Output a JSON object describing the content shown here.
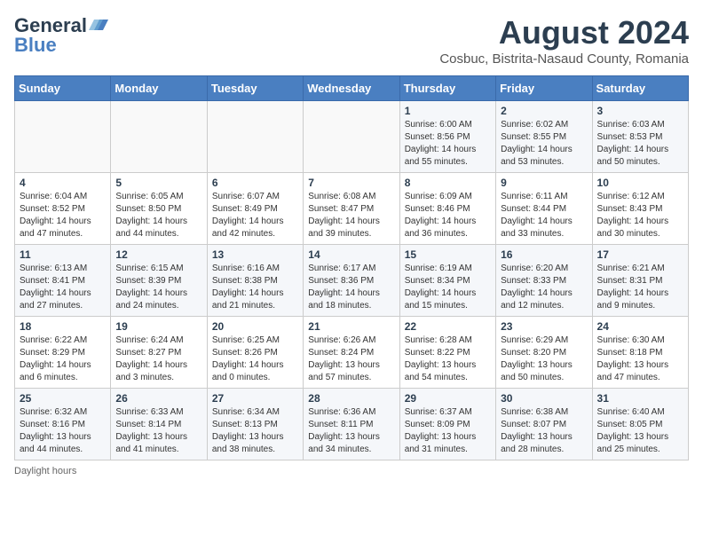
{
  "header": {
    "logo_line1": "General",
    "logo_line2": "Blue",
    "month_year": "August 2024",
    "location": "Cosbuc, Bistrita-Nasaud County, Romania"
  },
  "days_of_week": [
    "Sunday",
    "Monday",
    "Tuesday",
    "Wednesday",
    "Thursday",
    "Friday",
    "Saturday"
  ],
  "weeks": [
    [
      {
        "day": "",
        "info": ""
      },
      {
        "day": "",
        "info": ""
      },
      {
        "day": "",
        "info": ""
      },
      {
        "day": "",
        "info": ""
      },
      {
        "day": "1",
        "info": "Sunrise: 6:00 AM\nSunset: 8:56 PM\nDaylight: 14 hours\nand 55 minutes."
      },
      {
        "day": "2",
        "info": "Sunrise: 6:02 AM\nSunset: 8:55 PM\nDaylight: 14 hours\nand 53 minutes."
      },
      {
        "day": "3",
        "info": "Sunrise: 6:03 AM\nSunset: 8:53 PM\nDaylight: 14 hours\nand 50 minutes."
      }
    ],
    [
      {
        "day": "4",
        "info": "Sunrise: 6:04 AM\nSunset: 8:52 PM\nDaylight: 14 hours\nand 47 minutes."
      },
      {
        "day": "5",
        "info": "Sunrise: 6:05 AM\nSunset: 8:50 PM\nDaylight: 14 hours\nand 44 minutes."
      },
      {
        "day": "6",
        "info": "Sunrise: 6:07 AM\nSunset: 8:49 PM\nDaylight: 14 hours\nand 42 minutes."
      },
      {
        "day": "7",
        "info": "Sunrise: 6:08 AM\nSunset: 8:47 PM\nDaylight: 14 hours\nand 39 minutes."
      },
      {
        "day": "8",
        "info": "Sunrise: 6:09 AM\nSunset: 8:46 PM\nDaylight: 14 hours\nand 36 minutes."
      },
      {
        "day": "9",
        "info": "Sunrise: 6:11 AM\nSunset: 8:44 PM\nDaylight: 14 hours\nand 33 minutes."
      },
      {
        "day": "10",
        "info": "Sunrise: 6:12 AM\nSunset: 8:43 PM\nDaylight: 14 hours\nand 30 minutes."
      }
    ],
    [
      {
        "day": "11",
        "info": "Sunrise: 6:13 AM\nSunset: 8:41 PM\nDaylight: 14 hours\nand 27 minutes."
      },
      {
        "day": "12",
        "info": "Sunrise: 6:15 AM\nSunset: 8:39 PM\nDaylight: 14 hours\nand 24 minutes."
      },
      {
        "day": "13",
        "info": "Sunrise: 6:16 AM\nSunset: 8:38 PM\nDaylight: 14 hours\nand 21 minutes."
      },
      {
        "day": "14",
        "info": "Sunrise: 6:17 AM\nSunset: 8:36 PM\nDaylight: 14 hours\nand 18 minutes."
      },
      {
        "day": "15",
        "info": "Sunrise: 6:19 AM\nSunset: 8:34 PM\nDaylight: 14 hours\nand 15 minutes."
      },
      {
        "day": "16",
        "info": "Sunrise: 6:20 AM\nSunset: 8:33 PM\nDaylight: 14 hours\nand 12 minutes."
      },
      {
        "day": "17",
        "info": "Sunrise: 6:21 AM\nSunset: 8:31 PM\nDaylight: 14 hours\nand 9 minutes."
      }
    ],
    [
      {
        "day": "18",
        "info": "Sunrise: 6:22 AM\nSunset: 8:29 PM\nDaylight: 14 hours\nand 6 minutes."
      },
      {
        "day": "19",
        "info": "Sunrise: 6:24 AM\nSunset: 8:27 PM\nDaylight: 14 hours\nand 3 minutes."
      },
      {
        "day": "20",
        "info": "Sunrise: 6:25 AM\nSunset: 8:26 PM\nDaylight: 14 hours\nand 0 minutes."
      },
      {
        "day": "21",
        "info": "Sunrise: 6:26 AM\nSunset: 8:24 PM\nDaylight: 13 hours\nand 57 minutes."
      },
      {
        "day": "22",
        "info": "Sunrise: 6:28 AM\nSunset: 8:22 PM\nDaylight: 13 hours\nand 54 minutes."
      },
      {
        "day": "23",
        "info": "Sunrise: 6:29 AM\nSunset: 8:20 PM\nDaylight: 13 hours\nand 50 minutes."
      },
      {
        "day": "24",
        "info": "Sunrise: 6:30 AM\nSunset: 8:18 PM\nDaylight: 13 hours\nand 47 minutes."
      }
    ],
    [
      {
        "day": "25",
        "info": "Sunrise: 6:32 AM\nSunset: 8:16 PM\nDaylight: 13 hours\nand 44 minutes."
      },
      {
        "day": "26",
        "info": "Sunrise: 6:33 AM\nSunset: 8:14 PM\nDaylight: 13 hours\nand 41 minutes."
      },
      {
        "day": "27",
        "info": "Sunrise: 6:34 AM\nSunset: 8:13 PM\nDaylight: 13 hours\nand 38 minutes."
      },
      {
        "day": "28",
        "info": "Sunrise: 6:36 AM\nSunset: 8:11 PM\nDaylight: 13 hours\nand 34 minutes."
      },
      {
        "day": "29",
        "info": "Sunrise: 6:37 AM\nSunset: 8:09 PM\nDaylight: 13 hours\nand 31 minutes."
      },
      {
        "day": "30",
        "info": "Sunrise: 6:38 AM\nSunset: 8:07 PM\nDaylight: 13 hours\nand 28 minutes."
      },
      {
        "day": "31",
        "info": "Sunrise: 6:40 AM\nSunset: 8:05 PM\nDaylight: 13 hours\nand 25 minutes."
      }
    ]
  ],
  "footer": {
    "daylight_label": "Daylight hours"
  }
}
